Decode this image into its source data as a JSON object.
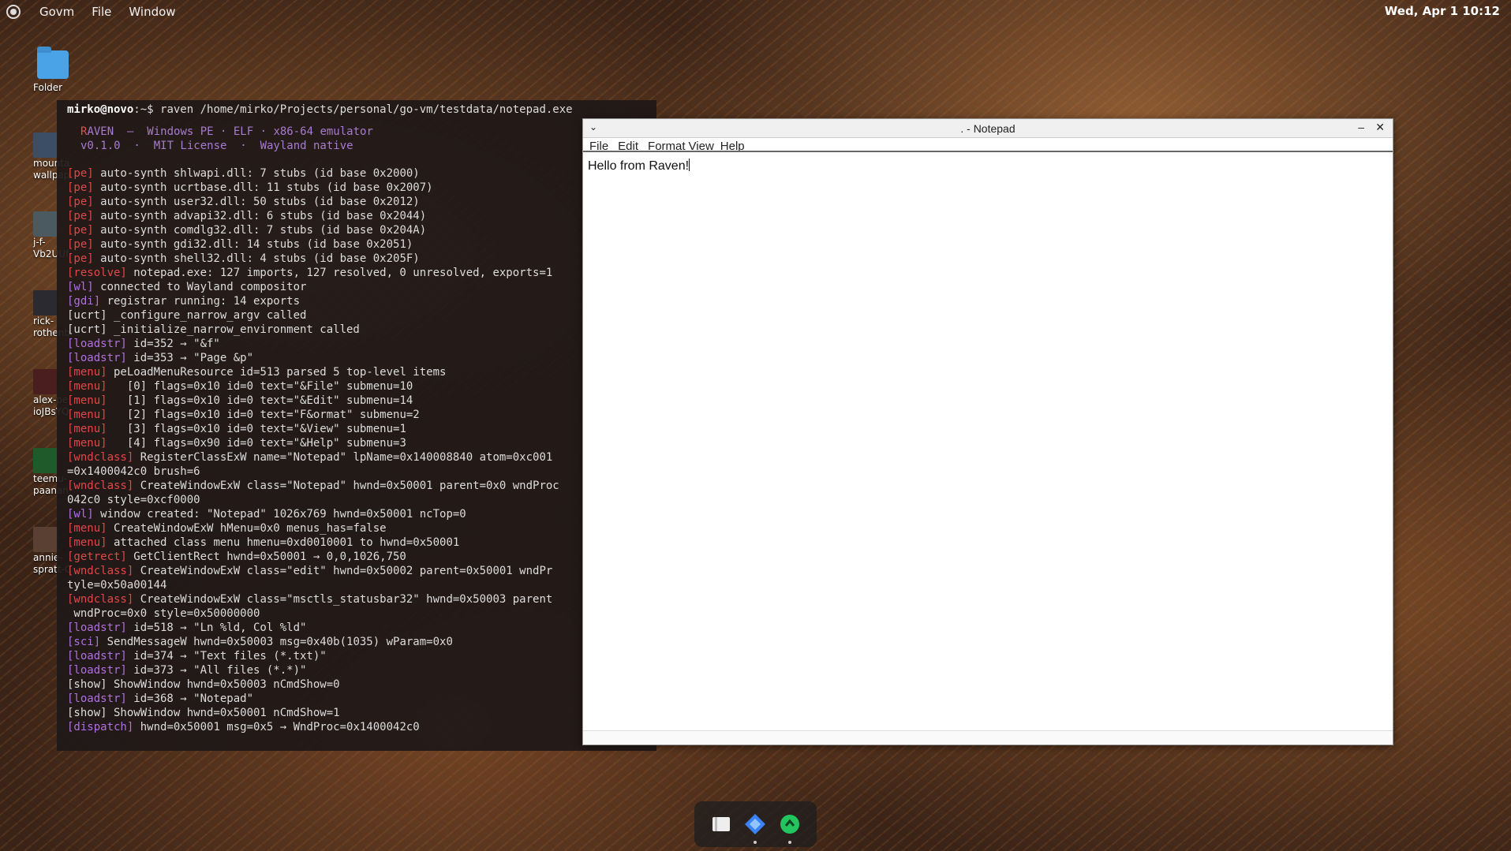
{
  "topbar": {
    "menus": [
      "Govm",
      "File",
      "Window"
    ],
    "clock": "Wed, Apr  1 10:12"
  },
  "desktop_icons": [
    {
      "label": "Folder"
    },
    {
      "label": "mounta\nwallpap"
    },
    {
      "label": "j-f-\nVb2UUf"
    },
    {
      "label": "rick-\nrothenb"
    },
    {
      "label": "alex-pe\nioJBsYQ"
    },
    {
      "label": "teemu-\npaanan"
    },
    {
      "label": "annie-\nspratt-C"
    }
  ],
  "terminal": {
    "prompt_user": "mirko@novo",
    "prompt_path": ":~$ ",
    "command": "raven /home/mirko/Projects/personal/go-vm/testdata/notepad.exe",
    "banner": {
      "line1_r": "R",
      "line1": "AVEN  —  Windows PE · ELF · x86-64 emulator",
      "line2": "v0.1.0  ·  MIT License  ·  Wayland native"
    },
    "lines": [
      {
        "tag": "[pe]",
        "kind": "pe",
        "text": " auto-synth shlwapi.dll: 7 stubs (id base 0x2000)"
      },
      {
        "tag": "[pe]",
        "kind": "pe",
        "text": " auto-synth ucrtbase.dll: 11 stubs (id base 0x2007)"
      },
      {
        "tag": "[pe]",
        "kind": "pe",
        "text": " auto-synth user32.dll: 50 stubs (id base 0x2012)"
      },
      {
        "tag": "[pe]",
        "kind": "pe",
        "text": " auto-synth advapi32.dll: 6 stubs (id base 0x2044)"
      },
      {
        "tag": "[pe]",
        "kind": "pe",
        "text": " auto-synth comdlg32.dll: 7 stubs (id base 0x204A)"
      },
      {
        "tag": "[pe]",
        "kind": "pe",
        "text": " auto-synth gdi32.dll: 14 stubs (id base 0x2051)"
      },
      {
        "tag": "[pe]",
        "kind": "pe",
        "text": " auto-synth shell32.dll: 4 stubs (id base 0x205F)"
      },
      {
        "tag": "[resolve]",
        "kind": "resolve",
        "text": " notepad.exe: 127 imports, 127 resolved, 0 unresolved, exports=1"
      },
      {
        "tag": "[wl]",
        "kind": "wl",
        "text": " connected to Wayland compositor"
      },
      {
        "tag": "[gdi]",
        "kind": "gdi",
        "text": " registrar running: 14 exports"
      },
      {
        "tag": "",
        "kind": "plain",
        "text": "[ucrt] _configure_narrow_argv called"
      },
      {
        "tag": "",
        "kind": "plain",
        "text": "[ucrt] _initialize_narrow_environment called"
      },
      {
        "tag": "[loadstr]",
        "kind": "loadstr",
        "text": " id=352 → \"&f\""
      },
      {
        "tag": "[loadstr]",
        "kind": "loadstr",
        "text": " id=353 → \"Page &p\""
      },
      {
        "tag": "[menu]",
        "kind": "menu",
        "text": " peLoadMenuResource id=513 parsed 5 top-level items"
      },
      {
        "tag": "[menu]",
        "kind": "menu",
        "text": "   [0] flags=0x10 id=0 text=\"&File\" submenu=10"
      },
      {
        "tag": "[menu]",
        "kind": "menu",
        "text": "   [1] flags=0x10 id=0 text=\"&Edit\" submenu=14"
      },
      {
        "tag": "[menu]",
        "kind": "menu",
        "text": "   [2] flags=0x10 id=0 text=\"F&ormat\" submenu=2"
      },
      {
        "tag": "[menu]",
        "kind": "menu",
        "text": "   [3] flags=0x10 id=0 text=\"&View\" submenu=1"
      },
      {
        "tag": "[menu]",
        "kind": "menu",
        "text": "   [4] flags=0x90 id=0 text=\"&Help\" submenu=3"
      },
      {
        "tag": "[wndclass]",
        "kind": "wndclass",
        "text": " RegisterClassExW name=\"Notepad\" lpName=0x140008840 atom=0xc001"
      },
      {
        "tag": "",
        "kind": "plain",
        "text": "=0x1400042c0 brush=6"
      },
      {
        "tag": "[wndclass]",
        "kind": "wndclass",
        "text": " CreateWindowExW class=\"Notepad\" hwnd=0x50001 parent=0x0 wndProc"
      },
      {
        "tag": "",
        "kind": "plain",
        "text": "042c0 style=0xcf0000"
      },
      {
        "tag": "[wl]",
        "kind": "wl",
        "text": " window created: \"Notepad\" 1026x769 hwnd=0x50001 ncTop=0"
      },
      {
        "tag": "[menu]",
        "kind": "menu",
        "text": " CreateWindowExW hMenu=0x0 menus_has=false"
      },
      {
        "tag": "[menu]",
        "kind": "menu",
        "text": " attached class menu hmenu=0xd0010001 to hwnd=0x50001"
      },
      {
        "tag": "[getrect]",
        "kind": "getrect",
        "text": " GetClientRect hwnd=0x50001 → 0,0,1026,750"
      },
      {
        "tag": "[wndclass]",
        "kind": "wndclass",
        "text": " CreateWindowExW class=\"edit\" hwnd=0x50002 parent=0x50001 wndPr"
      },
      {
        "tag": "",
        "kind": "plain",
        "text": "tyle=0x50a00144"
      },
      {
        "tag": "[wndclass]",
        "kind": "wndclass",
        "text": " CreateWindowExW class=\"msctls_statusbar32\" hwnd=0x50003 parent"
      },
      {
        "tag": "",
        "kind": "plain",
        "text": " wndProc=0x0 style=0x50000000"
      },
      {
        "tag": "[loadstr]",
        "kind": "loadstr",
        "text": " id=518 → \"Ln %ld, Col %ld\""
      },
      {
        "tag": "[sci]",
        "kind": "sci",
        "text": " SendMessageW hwnd=0x50003 msg=0x40b(1035) wParam=0x0"
      },
      {
        "tag": "[loadstr]",
        "kind": "loadstr",
        "text": " id=374 → \"Text files (*.txt)\""
      },
      {
        "tag": "[loadstr]",
        "kind": "loadstr",
        "text": " id=373 → \"All files (*.*)\""
      },
      {
        "tag": "",
        "kind": "plain",
        "text": "[show] ShowWindow hwnd=0x50003 nCmdShow=0"
      },
      {
        "tag": "[loadstr]",
        "kind": "loadstr",
        "text": " id=368 → \"Notepad\""
      },
      {
        "tag": "",
        "kind": "plain",
        "text": "[show] ShowWindow hwnd=0x50001 nCmdShow=1"
      },
      {
        "tag": "[dispatch]",
        "kind": "dispatch",
        "text": " hwnd=0x50001 msg=0x5 → WndProc=0x1400042c0"
      }
    ]
  },
  "notepad": {
    "title": ". - Notepad",
    "menu": [
      "File",
      "Edit",
      "Format",
      "View",
      "Help"
    ],
    "content": "Hello from Raven!"
  },
  "colors": {
    "terminal_bg": "#1e1818",
    "tag_red": "#e04848",
    "tag_purple": "#b070e0",
    "banner_purple": "#a77bcf",
    "dock_blue": "#3b82f6",
    "dock_green": "#22c55e"
  },
  "dock": {
    "items": [
      {
        "icon": "files-icon"
      },
      {
        "icon": "vscode-icon"
      },
      {
        "icon": "app-green-icon"
      }
    ]
  }
}
